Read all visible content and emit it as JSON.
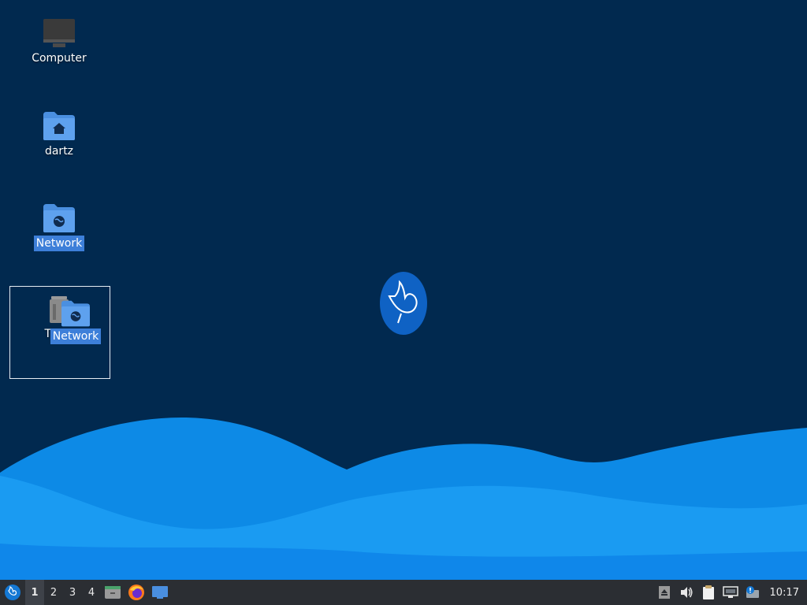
{
  "desktop": {
    "icons": [
      {
        "name": "computer",
        "label": "Computer",
        "icon": "computer-icon"
      },
      {
        "name": "home",
        "label": "dartz",
        "icon": "home-folder-icon"
      },
      {
        "name": "network",
        "label": "Network",
        "icon": "network-folder-icon",
        "selected": true
      },
      {
        "name": "trash",
        "label": "Trash",
        "icon": "trash-icon"
      }
    ],
    "drag_ghost": {
      "label": "Network",
      "icon": "network-folder-icon"
    }
  },
  "taskbar": {
    "menu_icon": "whisker-menu-icon",
    "workspaces": [
      "1",
      "2",
      "3",
      "4"
    ],
    "active_workspace": "1",
    "launchers": [
      "file-manager-icon",
      "firefox-icon",
      "show-desktop-icon"
    ],
    "tray": [
      "eject-icon",
      "volume-icon",
      "clipboard-icon",
      "network-status-icon",
      "updates-icon"
    ],
    "clock": "10:17"
  },
  "colors": {
    "background": "#01294f",
    "taskbar": "#2b2e33",
    "selection": "#3d7fd9",
    "wave_light": "#1296f0",
    "wave_dark": "#0a6fd6"
  }
}
